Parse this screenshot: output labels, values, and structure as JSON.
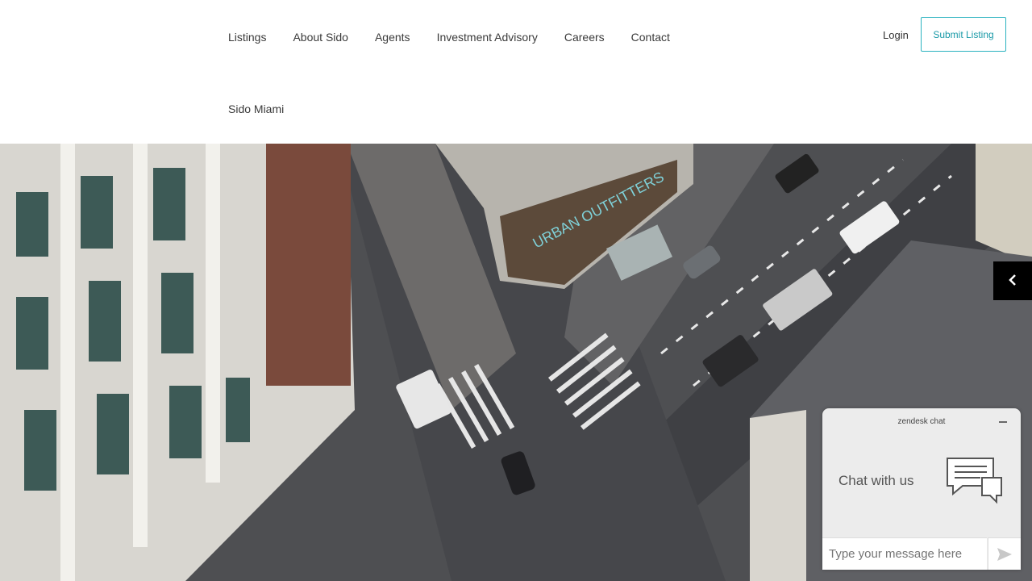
{
  "nav": {
    "items": [
      "Listings",
      "About Sido",
      "Agents",
      "Investment Advisory",
      "Careers",
      "Contact"
    ],
    "second_row": "Sido Miami",
    "login": "Login",
    "submit": "Submit Listing"
  },
  "hero": {
    "image": "aerial-city-intersection-photo",
    "storefront_text": "URBAN OUTFITTERS"
  },
  "carousel": {
    "prev_icon": "chevron-left-icon"
  },
  "chat": {
    "brand": "zendesk chat",
    "title": "Chat with us",
    "placeholder": "Type your message here",
    "minimize_icon": "minus-icon",
    "send_icon": "send-icon",
    "bubble_icon": "chat-bubbles-icon"
  },
  "colors": {
    "accent": "#2bb3c0",
    "chat_bg": "#ececec"
  }
}
